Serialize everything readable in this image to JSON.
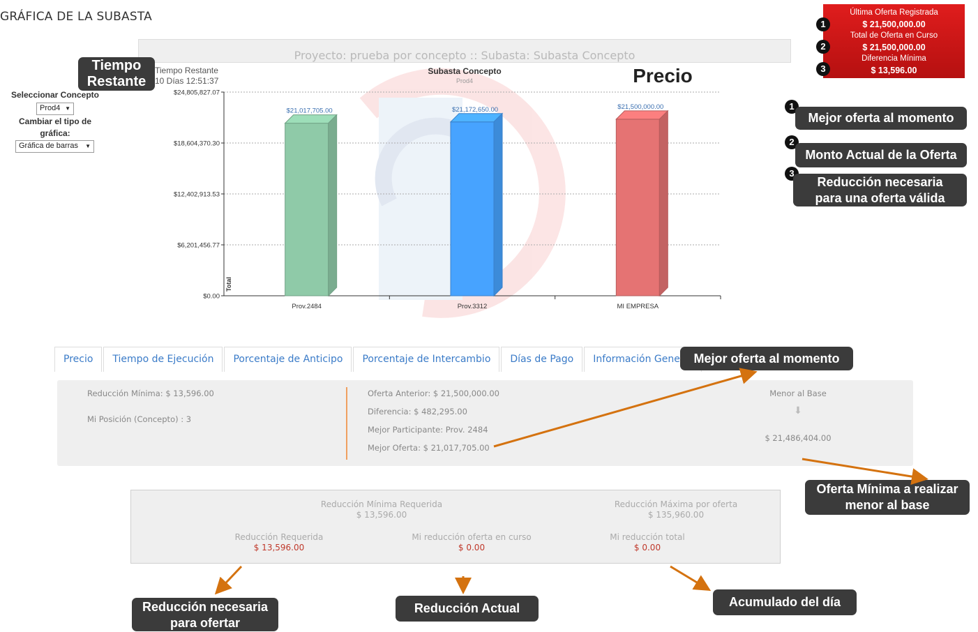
{
  "page_title": "GRÁFICA DE LA SUBASTA",
  "project_bar": "Proyecto: prueba por concepto :: Subasta: Subasta Concepto",
  "time": {
    "label": "Tiempo Restante",
    "value": "10 Días 12:51:37"
  },
  "sidebar": {
    "concept_label": "Seleccionar Concepto",
    "concept_value": "Prod4",
    "chart_type_label_1": "Cambiar el tipo de",
    "chart_type_label_2": "gráfica:",
    "chart_type_value": "Gráfica de barras"
  },
  "red_box": {
    "last_offer_label": "Última Oferta Registrada",
    "last_offer_value": "$ 21,500,000.00",
    "total_label": "Total de Oferta en Curso",
    "total_value": "$ 21,500,000.00",
    "diff_label": "Diferencia Mínima",
    "diff_value": "$ 13,596.00"
  },
  "callouts": {
    "tiempo_1": "Tiempo",
    "tiempo_2": "Restante",
    "precio": "Precio",
    "n1": "1",
    "n2": "2",
    "n3": "3",
    "mejor_oferta": "Mejor oferta al momento",
    "monto_actual": "Monto Actual de la Oferta",
    "reduccion_1": "Reducción necesaria",
    "reduccion_2": "para una oferta válida",
    "mejor_oferta_2": "Mejor oferta al momento",
    "oferta_minima_1": "Oferta Mínima a realizar",
    "oferta_minima_2": "menor al base",
    "red_nec_1": "Reducción necesaria",
    "red_nec_2": "para ofertar",
    "red_actual": "Reducción Actual",
    "acumulado": "Acumulado del día"
  },
  "chart_data": {
    "type": "bar",
    "title": "Subasta Concepto",
    "subtitle": "Prod4",
    "ylabel": "Total",
    "categories": [
      "Prov.2484",
      "Prov.3312",
      "MI EMPRESA"
    ],
    "values": [
      21017705.0,
      21172650.0,
      21500000.0
    ],
    "value_labels": [
      "$21,017,705.00",
      "$21,172,650.00",
      "$21,500,000.00"
    ],
    "colors": [
      "#8fcaa8",
      "#47a3ff",
      "#e57373"
    ],
    "ylim": [
      0,
      24805827.07
    ],
    "yticks": [
      "$24,805,827.07",
      "$18,604,370.30",
      "$12,402,913.53",
      "$6,201,456.77",
      "$0.00"
    ],
    "grid": true
  },
  "tabs": [
    "Precio",
    "Tiempo de Ejecución",
    "Porcentaje de Anticipo",
    "Porcentaje de Intercambio",
    "Días de Pago",
    "Información General"
  ],
  "panel": {
    "reduccion_minima": "Reducción Mínima: $ 13,596.00",
    "mi_posicion": "Mi Posición (Concepto) : 3",
    "oferta_anterior": "Oferta Anterior: $ 21,500,000.00",
    "diferencia": "Diferencia: $ 482,295.00",
    "mejor_participante": "Mejor Participante: Prov. 2484",
    "mejor_oferta": "Mejor Oferta: $ 21,017,705.00",
    "menor_base_label": "Menor al Base",
    "arrow": "⬇",
    "menor_base_value": "$ 21,486,404.00"
  },
  "reductions": {
    "min_req_label": "Reducción Mínima Requerida",
    "min_req_value": "$ 13,596.00",
    "max_label": "Reducción Máxima por oferta",
    "max_value": "$ 135,960.00",
    "req_label": "Reducción Requerida",
    "req_value": "$ 13,596.00",
    "curso_label": "Mi reducción oferta en curso",
    "curso_value": "$ 0.00",
    "total_label": "Mi reducción total",
    "total_value": "$ 0.00"
  }
}
